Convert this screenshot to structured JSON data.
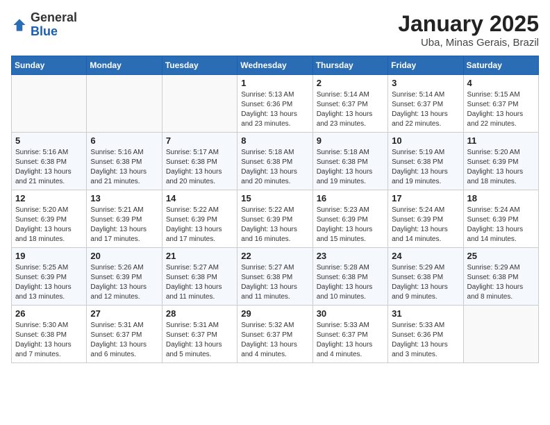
{
  "header": {
    "logo_line1": "General",
    "logo_line2": "Blue",
    "month": "January 2025",
    "location": "Uba, Minas Gerais, Brazil"
  },
  "weekdays": [
    "Sunday",
    "Monday",
    "Tuesday",
    "Wednesday",
    "Thursday",
    "Friday",
    "Saturday"
  ],
  "weeks": [
    [
      {
        "day": "",
        "info": ""
      },
      {
        "day": "",
        "info": ""
      },
      {
        "day": "",
        "info": ""
      },
      {
        "day": "1",
        "info": "Sunrise: 5:13 AM\nSunset: 6:36 PM\nDaylight: 13 hours\nand 23 minutes."
      },
      {
        "day": "2",
        "info": "Sunrise: 5:14 AM\nSunset: 6:37 PM\nDaylight: 13 hours\nand 23 minutes."
      },
      {
        "day": "3",
        "info": "Sunrise: 5:14 AM\nSunset: 6:37 PM\nDaylight: 13 hours\nand 22 minutes."
      },
      {
        "day": "4",
        "info": "Sunrise: 5:15 AM\nSunset: 6:37 PM\nDaylight: 13 hours\nand 22 minutes."
      }
    ],
    [
      {
        "day": "5",
        "info": "Sunrise: 5:16 AM\nSunset: 6:38 PM\nDaylight: 13 hours\nand 21 minutes."
      },
      {
        "day": "6",
        "info": "Sunrise: 5:16 AM\nSunset: 6:38 PM\nDaylight: 13 hours\nand 21 minutes."
      },
      {
        "day": "7",
        "info": "Sunrise: 5:17 AM\nSunset: 6:38 PM\nDaylight: 13 hours\nand 20 minutes."
      },
      {
        "day": "8",
        "info": "Sunrise: 5:18 AM\nSunset: 6:38 PM\nDaylight: 13 hours\nand 20 minutes."
      },
      {
        "day": "9",
        "info": "Sunrise: 5:18 AM\nSunset: 6:38 PM\nDaylight: 13 hours\nand 19 minutes."
      },
      {
        "day": "10",
        "info": "Sunrise: 5:19 AM\nSunset: 6:38 PM\nDaylight: 13 hours\nand 19 minutes."
      },
      {
        "day": "11",
        "info": "Sunrise: 5:20 AM\nSunset: 6:39 PM\nDaylight: 13 hours\nand 18 minutes."
      }
    ],
    [
      {
        "day": "12",
        "info": "Sunrise: 5:20 AM\nSunset: 6:39 PM\nDaylight: 13 hours\nand 18 minutes."
      },
      {
        "day": "13",
        "info": "Sunrise: 5:21 AM\nSunset: 6:39 PM\nDaylight: 13 hours\nand 17 minutes."
      },
      {
        "day": "14",
        "info": "Sunrise: 5:22 AM\nSunset: 6:39 PM\nDaylight: 13 hours\nand 17 minutes."
      },
      {
        "day": "15",
        "info": "Sunrise: 5:22 AM\nSunset: 6:39 PM\nDaylight: 13 hours\nand 16 minutes."
      },
      {
        "day": "16",
        "info": "Sunrise: 5:23 AM\nSunset: 6:39 PM\nDaylight: 13 hours\nand 15 minutes."
      },
      {
        "day": "17",
        "info": "Sunrise: 5:24 AM\nSunset: 6:39 PM\nDaylight: 13 hours\nand 14 minutes."
      },
      {
        "day": "18",
        "info": "Sunrise: 5:24 AM\nSunset: 6:39 PM\nDaylight: 13 hours\nand 14 minutes."
      }
    ],
    [
      {
        "day": "19",
        "info": "Sunrise: 5:25 AM\nSunset: 6:39 PM\nDaylight: 13 hours\nand 13 minutes."
      },
      {
        "day": "20",
        "info": "Sunrise: 5:26 AM\nSunset: 6:39 PM\nDaylight: 13 hours\nand 12 minutes."
      },
      {
        "day": "21",
        "info": "Sunrise: 5:27 AM\nSunset: 6:38 PM\nDaylight: 13 hours\nand 11 minutes."
      },
      {
        "day": "22",
        "info": "Sunrise: 5:27 AM\nSunset: 6:38 PM\nDaylight: 13 hours\nand 11 minutes."
      },
      {
        "day": "23",
        "info": "Sunrise: 5:28 AM\nSunset: 6:38 PM\nDaylight: 13 hours\nand 10 minutes."
      },
      {
        "day": "24",
        "info": "Sunrise: 5:29 AM\nSunset: 6:38 PM\nDaylight: 13 hours\nand 9 minutes."
      },
      {
        "day": "25",
        "info": "Sunrise: 5:29 AM\nSunset: 6:38 PM\nDaylight: 13 hours\nand 8 minutes."
      }
    ],
    [
      {
        "day": "26",
        "info": "Sunrise: 5:30 AM\nSunset: 6:38 PM\nDaylight: 13 hours\nand 7 minutes."
      },
      {
        "day": "27",
        "info": "Sunrise: 5:31 AM\nSunset: 6:37 PM\nDaylight: 13 hours\nand 6 minutes."
      },
      {
        "day": "28",
        "info": "Sunrise: 5:31 AM\nSunset: 6:37 PM\nDaylight: 13 hours\nand 5 minutes."
      },
      {
        "day": "29",
        "info": "Sunrise: 5:32 AM\nSunset: 6:37 PM\nDaylight: 13 hours\nand 4 minutes."
      },
      {
        "day": "30",
        "info": "Sunrise: 5:33 AM\nSunset: 6:37 PM\nDaylight: 13 hours\nand 4 minutes."
      },
      {
        "day": "31",
        "info": "Sunrise: 5:33 AM\nSunset: 6:36 PM\nDaylight: 13 hours\nand 3 minutes."
      },
      {
        "day": "",
        "info": ""
      }
    ]
  ]
}
